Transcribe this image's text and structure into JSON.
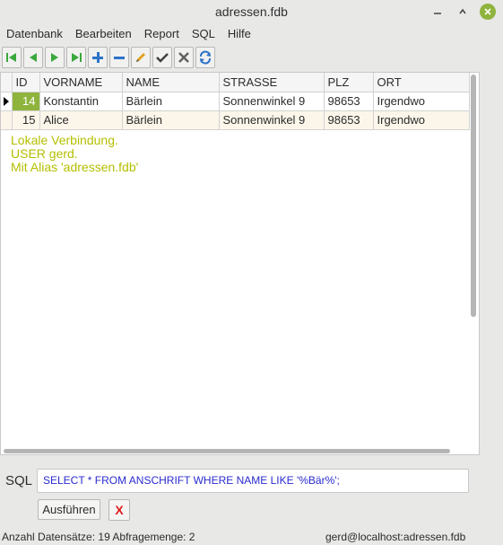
{
  "window": {
    "title": "adressen.fdb"
  },
  "menu": [
    "Datenbank",
    "Bearbeiten",
    "Report",
    "SQL",
    "Hilfe"
  ],
  "toolbar": {
    "buttons": [
      {
        "name": "first-record",
        "color": "#3aa83a"
      },
      {
        "name": "prior-record",
        "color": "#3aa83a"
      },
      {
        "name": "next-record",
        "color": "#3aa83a"
      },
      {
        "name": "last-record",
        "color": "#3aa83a"
      },
      {
        "name": "insert-record",
        "color": "#2f73c8"
      },
      {
        "name": "delete-record",
        "color": "#2f73c8"
      },
      {
        "name": "edit-record",
        "color": "#e0a020"
      },
      {
        "name": "post-record",
        "color": "#404040"
      },
      {
        "name": "cancel-edit",
        "color": "#606060"
      },
      {
        "name": "refresh-data",
        "color": "#2f73c8"
      }
    ]
  },
  "grid": {
    "columns": [
      "ID",
      "VORNAME",
      "NAME",
      "STRASSE",
      "PLZ",
      "ORT"
    ],
    "rows": [
      {
        "id": "14",
        "vorname": "Konstantin",
        "name": "Bärlein",
        "strasse": "Sonnenwinkel 9",
        "plz": "98653",
        "ort": "Irgendwo"
      },
      {
        "id": "15",
        "vorname": "Alice",
        "name": "Bärlein",
        "strasse": "Sonnenwinkel 9",
        "plz": "98653",
        "ort": "Irgendwo"
      }
    ],
    "message": [
      "Lokale Verbindung.",
      "USER gerd.",
      "Mit Alias 'adressen.fdb'"
    ]
  },
  "sql": {
    "label": "SQL",
    "query": "SELECT * FROM ANSCHRIFT WHERE NAME LIKE '%Bär%';",
    "execute_label": "Ausführen",
    "clear_label": "X"
  },
  "status": {
    "left": "Anzahl Datensätze: 19  Abfragemenge: 2",
    "right": "gerd@localhost:adressen.fdb"
  },
  "colors": {
    "accent": "#8fb43e",
    "message": "#b4bf00",
    "query": "#2a2ad0",
    "clear": "#e01c1c"
  }
}
